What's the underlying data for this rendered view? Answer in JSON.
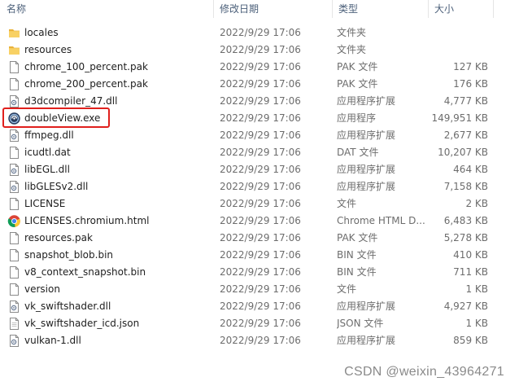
{
  "columns": {
    "name": "名称",
    "date": "修改日期",
    "type": "类型",
    "size": "大小"
  },
  "files": [
    {
      "name": "locales",
      "date": "2022/9/29 17:06",
      "type": "文件夹",
      "size": "",
      "icon": "folder-icon"
    },
    {
      "name": "resources",
      "date": "2022/9/29 17:06",
      "type": "文件夹",
      "size": "",
      "icon": "folder-icon"
    },
    {
      "name": "chrome_100_percent.pak",
      "date": "2022/9/29 17:06",
      "type": "PAK 文件",
      "size": "127 KB",
      "icon": "file-icon"
    },
    {
      "name": "chrome_200_percent.pak",
      "date": "2022/9/29 17:06",
      "type": "PAK 文件",
      "size": "176 KB",
      "icon": "file-icon"
    },
    {
      "name": "d3dcompiler_47.dll",
      "date": "2022/9/29 17:06",
      "type": "应用程序扩展",
      "size": "4,777 KB",
      "icon": "dll-icon"
    },
    {
      "name": "doubleView.exe",
      "date": "2022/9/29 17:06",
      "type": "应用程序",
      "size": "149,951 KB",
      "icon": "app-icon"
    },
    {
      "name": "ffmpeg.dll",
      "date": "2022/9/29 17:06",
      "type": "应用程序扩展",
      "size": "2,677 KB",
      "icon": "dll-icon"
    },
    {
      "name": "icudtl.dat",
      "date": "2022/9/29 17:06",
      "type": "DAT 文件",
      "size": "10,207 KB",
      "icon": "file-icon"
    },
    {
      "name": "libEGL.dll",
      "date": "2022/9/29 17:06",
      "type": "应用程序扩展",
      "size": "464 KB",
      "icon": "dll-icon"
    },
    {
      "name": "libGLESv2.dll",
      "date": "2022/9/29 17:06",
      "type": "应用程序扩展",
      "size": "7,158 KB",
      "icon": "dll-icon"
    },
    {
      "name": "LICENSE",
      "date": "2022/9/29 17:06",
      "type": "文件",
      "size": "2 KB",
      "icon": "file-icon"
    },
    {
      "name": "LICENSES.chromium.html",
      "date": "2022/9/29 17:06",
      "type": "Chrome HTML D...",
      "size": "6,483 KB",
      "icon": "chrome-icon"
    },
    {
      "name": "resources.pak",
      "date": "2022/9/29 17:06",
      "type": "PAK 文件",
      "size": "5,278 KB",
      "icon": "file-icon"
    },
    {
      "name": "snapshot_blob.bin",
      "date": "2022/9/29 17:06",
      "type": "BIN 文件",
      "size": "410 KB",
      "icon": "file-icon"
    },
    {
      "name": "v8_context_snapshot.bin",
      "date": "2022/9/29 17:06",
      "type": "BIN 文件",
      "size": "711 KB",
      "icon": "file-icon"
    },
    {
      "name": "version",
      "date": "2022/9/29 17:06",
      "type": "文件",
      "size": "1 KB",
      "icon": "file-icon"
    },
    {
      "name": "vk_swiftshader.dll",
      "date": "2022/9/29 17:06",
      "type": "应用程序扩展",
      "size": "4,927 KB",
      "icon": "dll-icon"
    },
    {
      "name": "vk_swiftshader_icd.json",
      "date": "2022/9/29 17:06",
      "type": "JSON 文件",
      "size": "1 KB",
      "icon": "json-icon"
    },
    {
      "name": "vulkan-1.dll",
      "date": "2022/9/29 17:06",
      "type": "应用程序扩展",
      "size": "859 KB",
      "icon": "dll-icon"
    }
  ],
  "highlighted_file": "doubleView.exe",
  "watermark": "CSDN @weixin_43964271",
  "colors": {
    "highlight": "#e0201d",
    "folder": "#f3c44a",
    "header_text": "#4c607a"
  }
}
